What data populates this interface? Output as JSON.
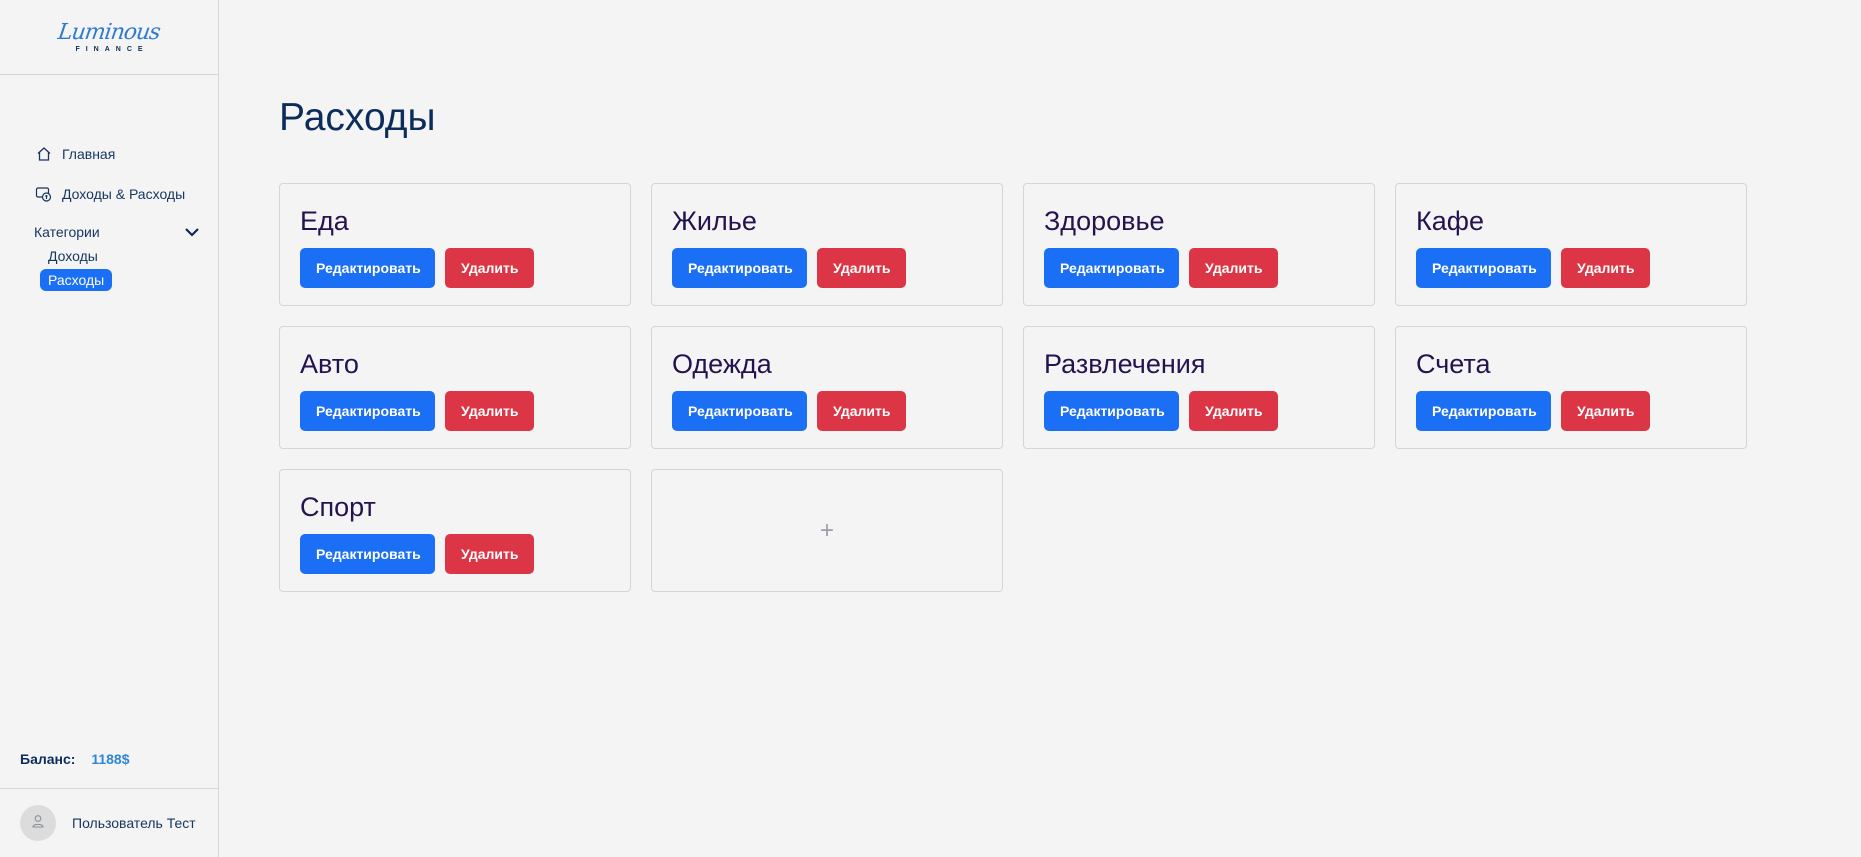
{
  "brand": {
    "logo_script": "Luminous",
    "logo_sub": "FINANCE"
  },
  "sidebar": {
    "nav": [
      {
        "label": "Главная",
        "icon": "home-icon"
      },
      {
        "label": "Доходы & Расходы",
        "icon": "money-exchange-icon"
      }
    ],
    "categories": {
      "label": "Категории",
      "items": [
        {
          "label": "Доходы",
          "active": false
        },
        {
          "label": "Расходы",
          "active": true
        }
      ]
    },
    "balance_label": "Баланс:",
    "balance_value": "1188$",
    "user_name": "Пользователь Тест"
  },
  "main": {
    "title": "Расходы",
    "edit_label": "Редактировать",
    "delete_label": "Удалить",
    "add_symbol": "+",
    "categories": [
      "Еда",
      "Жилье",
      "Здоровье",
      "Кафе",
      "Авто",
      "Одежда",
      "Развлечения",
      "Счета",
      "Спорт"
    ]
  },
  "colors": {
    "primary": "#1a6ff4",
    "danger": "#dc3545",
    "heading": "#0c2d5c",
    "card_title": "#24134f",
    "balance": "#2f86d6"
  }
}
